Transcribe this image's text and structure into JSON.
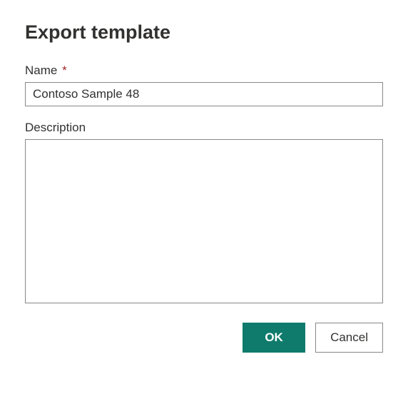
{
  "dialog": {
    "title": "Export template"
  },
  "fields": {
    "name": {
      "label": "Name",
      "required_indicator": "*",
      "value": "Contoso Sample 48"
    },
    "description": {
      "label": "Description",
      "value": ""
    }
  },
  "buttons": {
    "ok": "OK",
    "cancel": "Cancel"
  },
  "colors": {
    "primary": "#0f7b6c",
    "required": "#a4262c",
    "border": "#8a8886",
    "text": "#323130"
  }
}
